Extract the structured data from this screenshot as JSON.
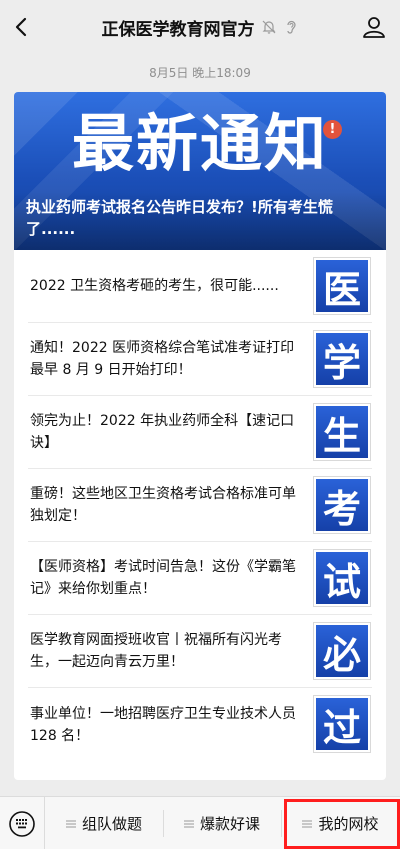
{
  "header": {
    "title": "正保医学教育网官方",
    "icons": [
      "back-arrow-icon",
      "bell-muted-icon",
      "ear-icon",
      "profile-icon"
    ]
  },
  "timestamp": "8月5日 晚上18:09",
  "banner": {
    "big_text": "最新通知",
    "badge": "!",
    "subtitle": "执业药师考试报名公告昨日发布？!所有考生慌了......"
  },
  "articles": [
    {
      "title": "2022 卫生资格考砸的考生，很可能......",
      "thumb": "医"
    },
    {
      "title": "通知！2022 医师资格综合笔试准考证打印最早 8 月 9 日开始打印！",
      "thumb": "学"
    },
    {
      "title": "领完为止！2022 年执业药师全科【速记口诀】",
      "thumb": "生"
    },
    {
      "title": "重磅！这些地区卫生资格考试合格标准可单独划定！",
      "thumb": "考"
    },
    {
      "title": "【医师资格】考试时间告急！这份《学霸笔记》来给你划重点！",
      "thumb": "试"
    },
    {
      "title": "医学教育网面授班收官丨祝福所有闪光考生，一起迈向青云万里！",
      "thumb": "必"
    },
    {
      "title": "事业单位！一地招聘医疗卫生专业技术人员 128 名！",
      "thumb": "过"
    }
  ],
  "bottom_menu": {
    "items": [
      "组队做题",
      "爆款好课",
      "我的网校"
    ],
    "icons": [
      "keyboard-icon",
      "menu-lines-icon"
    ],
    "highlight_color": "#ff1e1e"
  },
  "colors": {
    "banner_blue": "#1b4fb8",
    "badge_red": "#e2533c",
    "background": "#ededed"
  }
}
